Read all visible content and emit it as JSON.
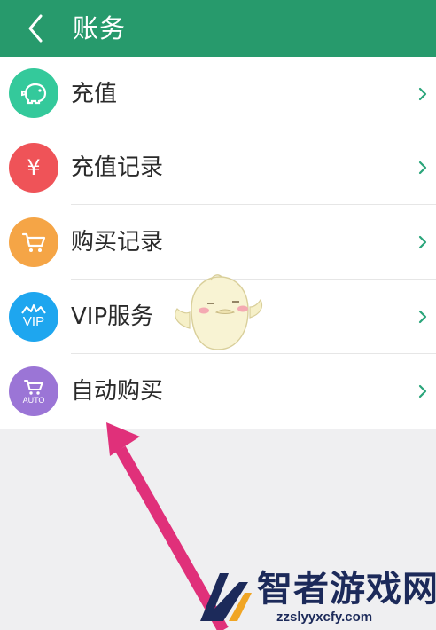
{
  "header": {
    "title": "账务",
    "back_icon": "chevron-left-icon",
    "background": "#279a6c"
  },
  "menu": {
    "items": [
      {
        "label": "充值",
        "icon": "piggy-bank-icon",
        "color": "#34c99b"
      },
      {
        "label": "充值记录",
        "icon": "yen-icon",
        "color": "#ef5358",
        "glyph": "¥"
      },
      {
        "label": "购买记录",
        "icon": "cart-icon",
        "color": "#f5a546"
      },
      {
        "label": "VIP服务",
        "icon": "vip-crown-icon",
        "color": "#1ea6ef",
        "glyph": "VIP"
      },
      {
        "label": "自动购买",
        "icon": "auto-cart-icon",
        "color": "#9b75d6",
        "glyph": "AUTO"
      }
    ],
    "chevron_icon": "chevron-right-icon",
    "chevron_color": "#2aa57a"
  },
  "annotation": {
    "arrow_color": "#e0307a",
    "mascot": "mascot-sticker"
  },
  "watermark": {
    "title": "智者游戏网",
    "url": "zzslyyxcfy.com",
    "logo": "zhizhe-logo-icon"
  }
}
